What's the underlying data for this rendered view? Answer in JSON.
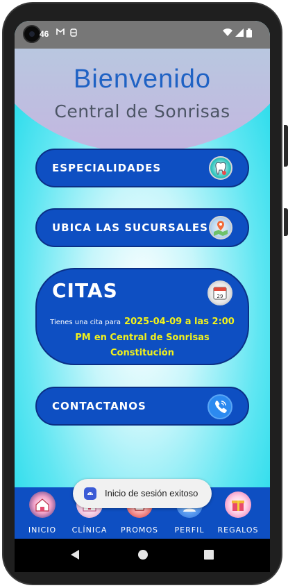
{
  "status_bar": {
    "time": "46",
    "left_icons": [
      "gmail-icon",
      "data-saver-icon"
    ],
    "right_icons": [
      "wifi-icon",
      "signal-icon",
      "battery-icon"
    ]
  },
  "header": {
    "title": "Bienvenido",
    "subtitle": "Central de Sonrisas"
  },
  "menu": {
    "especialidades": {
      "label": "ESPECIALIDADES",
      "icon": "tooth-icon"
    },
    "sucursales": {
      "label": "UBICA LAS SUCURSALES",
      "icon": "map-location-icon"
    },
    "contacto": {
      "label": "CONTACTANOS",
      "icon": "phone-icon"
    }
  },
  "citas": {
    "title": "CITAS",
    "icon": "calendar-icon",
    "calendar_day": "29",
    "message_prefix": "Tienes una cita para",
    "appointment_datetime": "2025-04-09 a las 2:00 PM",
    "appointment_location": "en Central de Sonrisas Constitución"
  },
  "toast": {
    "icon": "android-icon",
    "text": "Inicio de sesión exitoso"
  },
  "bottom_nav": {
    "items": [
      {
        "label": "INICIO",
        "icon": "home-icon"
      },
      {
        "label": "CLÍNICA",
        "icon": "clinic-icon"
      },
      {
        "label": "PROMOS",
        "icon": "promo-icon"
      },
      {
        "label": "PERFIL",
        "icon": "profile-icon"
      },
      {
        "label": "REGALOS",
        "icon": "gift-icon"
      }
    ]
  },
  "colors": {
    "primary": "#0e4fc2",
    "accent_text": "#f2f21a",
    "background": "#12d7e8",
    "title": "#1f62c4"
  }
}
